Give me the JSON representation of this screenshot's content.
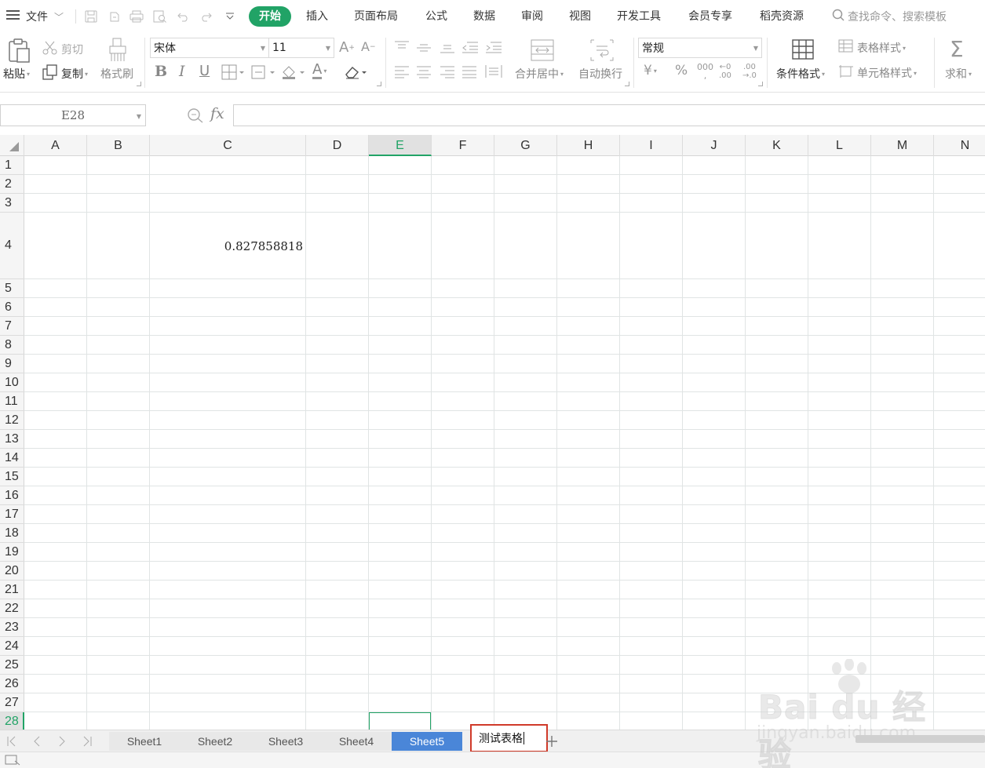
{
  "menubar": {
    "file_label": "文件",
    "tabs": [
      {
        "label": "开始",
        "active": true
      },
      {
        "label": "插入"
      },
      {
        "label": "页面布局"
      },
      {
        "label": "公式"
      },
      {
        "label": "数据"
      },
      {
        "label": "审阅"
      },
      {
        "label": "视图"
      },
      {
        "label": "开发工具"
      },
      {
        "label": "会员专享"
      },
      {
        "label": "稻壳资源"
      }
    ],
    "search_placeholder": "查找命令、搜索模板"
  },
  "ribbon": {
    "paste": "粘贴",
    "cut": "剪切",
    "copy": "复制",
    "format_painter": "格式刷",
    "font_name": "宋体",
    "font_size": "11",
    "merge_center": "合并居中",
    "wrap_text": "自动换行",
    "number_format": "常规",
    "conditional_format": "条件格式",
    "table_style": "表格样式",
    "cell_style": "单元格样式",
    "sum": "求和",
    "accent_color": "#21a366"
  },
  "formula_bar": {
    "name_box": "E28",
    "fx": "fx",
    "value": ""
  },
  "grid": {
    "columns": [
      "A",
      "B",
      "C",
      "D",
      "E",
      "F",
      "G",
      "H",
      "I",
      "J",
      "K",
      "L",
      "M",
      "N"
    ],
    "rows": [
      "1",
      "2",
      "3",
      "4",
      "5",
      "6",
      "7",
      "8",
      "9",
      "10",
      "11",
      "12",
      "13",
      "14",
      "15",
      "16",
      "17",
      "18",
      "19",
      "20",
      "21",
      "22",
      "23",
      "24",
      "25",
      "26",
      "27",
      "28"
    ],
    "active_column": "E",
    "active_row": "28",
    "cell_c4": "0.827858818"
  },
  "sheets": {
    "tabs": [
      "Sheet1",
      "Sheet2",
      "Sheet3",
      "Sheet4",
      "Sheet5"
    ],
    "selected": "Sheet5",
    "renaming_value": "测试表格",
    "rename_highlight_color": "#d03a2a"
  },
  "watermark": {
    "logo": "Bai du 经验",
    "url": "jingyan.baidu.com"
  }
}
